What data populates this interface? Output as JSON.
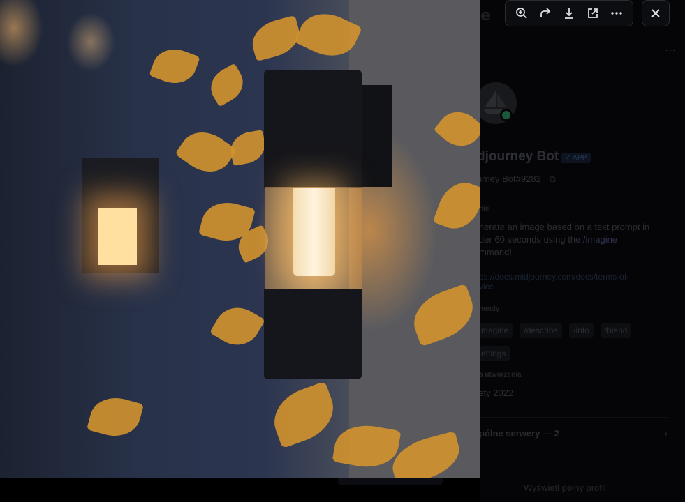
{
  "toolbar": {
    "icons": [
      "zoom-in-icon",
      "forward-icon",
      "download-icon",
      "open-external-icon",
      "more-icon"
    ],
    "close_icon": "close-icon"
  },
  "profile": {
    "bot_name": "djourney Bot",
    "bot_tag": "✓ APP",
    "handle": "urney Bot#9282",
    "about_label": "nie",
    "about_text_1": "nerate an image based on a text prompt in",
    "about_text_2": "der 60 seconds using the ",
    "about_cmd": "/imagine",
    "about_text_3": "mmand!",
    "link_text": "ps://docs.midjourney.com/docs/terms-of-",
    "link_text_2": "vice",
    "commands_label": "nendy",
    "commands": [
      "magine",
      "/describe",
      "/info",
      "/blend"
    ],
    "settings": "ettings",
    "created_label": "a utworzenia",
    "created_date": "sty 2022",
    "servers_label": "pólne serwery — 2",
    "view_profile": "Wyświetl pełny profil"
  },
  "colors": {
    "accent": "#5865f2",
    "panel_bg": "#050507",
    "toolbar_bg": "#0c0d10"
  }
}
